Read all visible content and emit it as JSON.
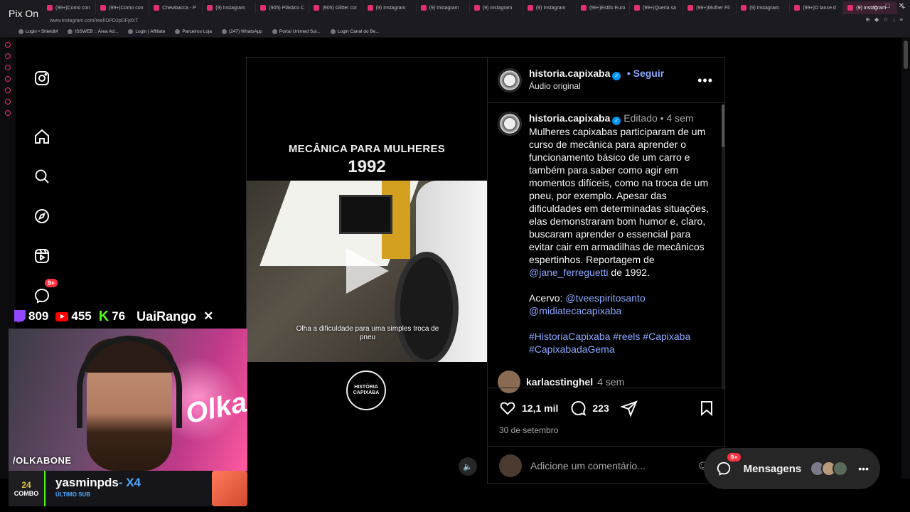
{
  "overlay": {
    "pix_label": "Pix On"
  },
  "browser": {
    "tabs": [
      {
        "label": "(99+)Como con"
      },
      {
        "label": "(99+)Como con"
      },
      {
        "label": "Chewbacca - P"
      },
      {
        "label": "(9) Instagram"
      },
      {
        "label": "(905) Plástico C"
      },
      {
        "label": "(905) Glitter cor"
      },
      {
        "label": "(9) Instagram"
      },
      {
        "label": "(9) Instagram"
      },
      {
        "label": "(9) Instagram"
      },
      {
        "label": "(9) Instagram"
      },
      {
        "label": "(99+)Estilo Euro"
      },
      {
        "label": "(99+)Queria sa"
      },
      {
        "label": "(99+)Mulher Fli"
      },
      {
        "label": "(9) Instagram"
      },
      {
        "label": "(99+)O lance d"
      },
      {
        "label": "(9) Instagram"
      }
    ],
    "url": "www.instagram.com/reel/DPD2pDFjdXT",
    "bookmarks": [
      {
        "label": "Login • ShieldM"
      },
      {
        "label": "ISSWEB :: Área Ad..."
      },
      {
        "label": "Login | Affiliate"
      },
      {
        "label": "Parceiros Loja"
      },
      {
        "label": "(247) WhatsApp"
      },
      {
        "label": "Portal Unimed Sul..."
      },
      {
        "label": "Login Canal do Be..."
      }
    ]
  },
  "post": {
    "video": {
      "title": "MECÂNICA PARA MULHERES",
      "year": "1992",
      "subtitle": "Olha a dificuldade para uma simples troca de pneu",
      "logo_text": "HISTÓRIA CAPIXABA"
    },
    "header": {
      "username": "historia.capixaba",
      "follow_label": "• Seguir",
      "audio": "Áudio original"
    },
    "caption": {
      "username": "historia.capixaba",
      "edited": "Editado",
      "time": "• 4 sem",
      "text": "Mulheres capixabas participaram de um curso de mecânica para aprender o funcionamento básico de um carro e também para saber como agir em momentos difíceis, como na troca de um pneu, por exemplo. Apesar das dificuldades em determinadas situações, elas demonstraram bom humor e, claro, buscaram aprender o essencial para evitar cair em armadilhas de mecânicos espertinhos. Reportagem de",
      "mention": "@jane_ferreguetti",
      "text_end": "de 1992.",
      "acervo_label": "Acervo:",
      "acervo1": "@tveespiritosanto",
      "acervo2": "@midiatecacapixaba",
      "hashtags1": "#HistoriaCapixaba #reels #Capixaba",
      "hashtags2": "#CapixabadaGema"
    },
    "comment": {
      "username": "karlacstinghel",
      "time": "4 sem"
    },
    "likes": "12,1 mil",
    "comments": "223",
    "date": "30 de setembro",
    "add_comment_placeholder": "Adicione um comentário..."
  },
  "messages": {
    "label": "Mensagens",
    "badge": "9+"
  },
  "nav": {
    "notif_badge": "9+"
  },
  "stream": {
    "twitch": "809",
    "youtube": "455",
    "kick": "76",
    "brand": "UaiRango",
    "kick_icon": "K",
    "cam_name": "/OLKABONE",
    "neon": "Olka",
    "combo_num": "24",
    "combo_label": "COMBO",
    "sub_user": "yasminpds",
    "sub_mult": "- X4",
    "sub_label": "ÚLTIMO SUB"
  }
}
